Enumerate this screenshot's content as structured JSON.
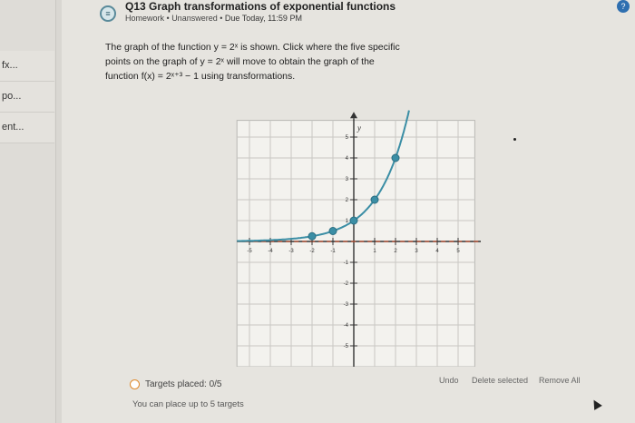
{
  "sidebar": {
    "items": [
      {
        "label": "fx..."
      },
      {
        "label": "po..."
      },
      {
        "label": "ent..."
      }
    ]
  },
  "header": {
    "icon": "list-icon",
    "title": "Q13 Graph transformations of exponential functions",
    "meta": {
      "type": "Homework",
      "status": "Unanswered",
      "due": "Due Today, 11:59 PM"
    }
  },
  "question": {
    "line1": "The graph of the function y = 2ˣ is shown. Click where the five specific",
    "line2": "points on the graph of y = 2ˣ will move to obtain the graph of the",
    "line3": "function f(x) = 2ˣ⁺³ − 1 using transformations."
  },
  "graph": {
    "x_axis_label": "x",
    "y_axis_label": "y",
    "x_ticks": [
      "-5",
      "-4",
      "-3",
      "-2",
      "-1",
      "1",
      "2",
      "3",
      "4",
      "5"
    ],
    "y_ticks": [
      "5",
      "4",
      "3",
      "2",
      "1",
      "-1",
      "-2",
      "-3",
      "-4",
      "-5"
    ],
    "points": [
      {
        "x": -2,
        "y": 0.25
      },
      {
        "x": -1,
        "y": 0.5
      },
      {
        "x": 0,
        "y": 1
      },
      {
        "x": 1,
        "y": 2
      },
      {
        "x": 2,
        "y": 4
      }
    ],
    "asymptote_y": 0
  },
  "footer": {
    "targets_label": "Targets placed: 0/5",
    "hint": "You can place up to 5 targets",
    "undo": "Undo",
    "delete_selected": "Delete selected",
    "remove_all": "Remove All"
  }
}
